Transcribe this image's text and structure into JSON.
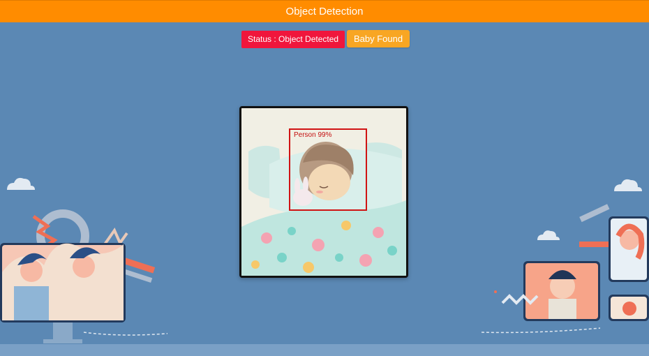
{
  "header": {
    "title": "Object Detection"
  },
  "status": {
    "text": "Status : Object Detected"
  },
  "action": {
    "label": "Baby Found"
  },
  "detection": {
    "label": "Person 99%",
    "confidence": 0.99
  },
  "colors": {
    "header": "#ff8c00",
    "background": "#5b88b4",
    "status_badge": "#f0163c",
    "found_button": "#f8a623",
    "bbox": "#d01313"
  }
}
